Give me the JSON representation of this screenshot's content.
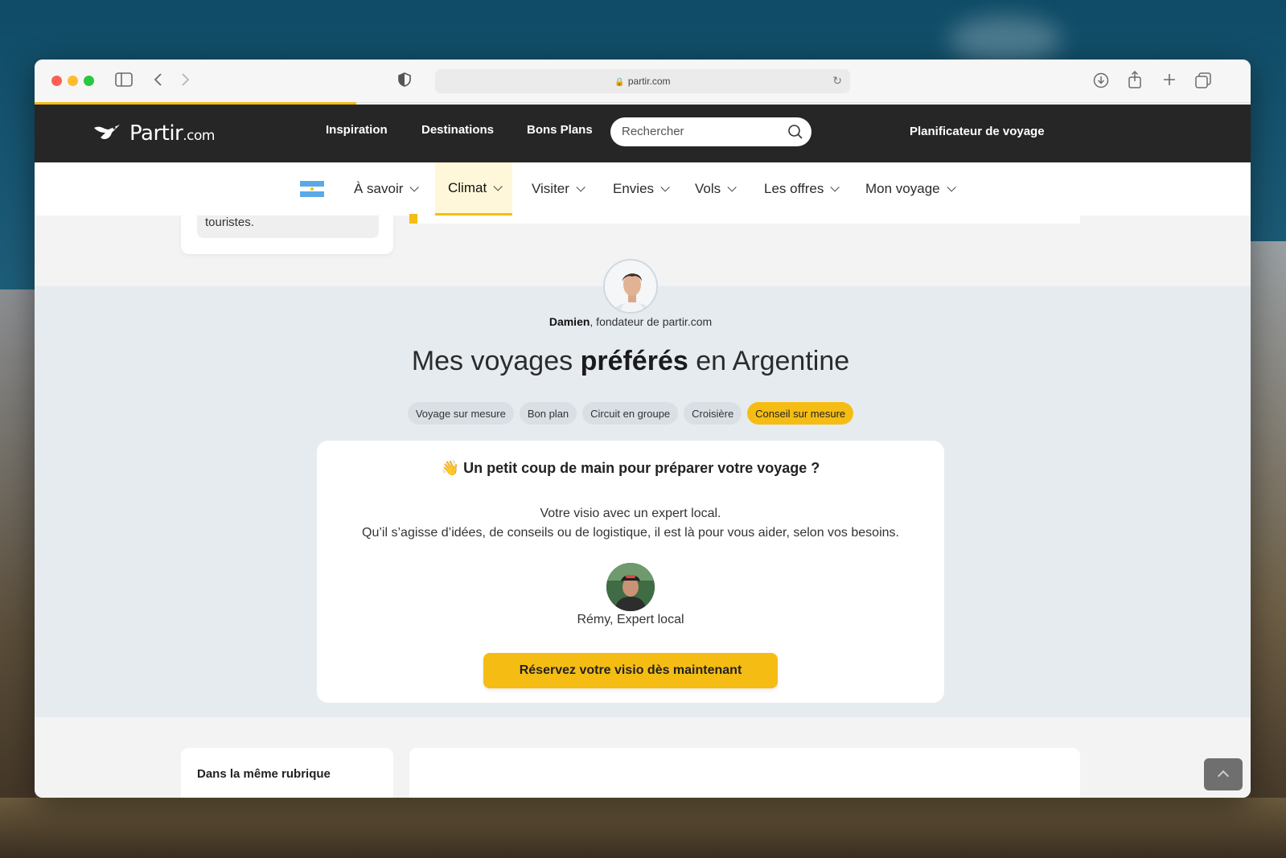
{
  "browser": {
    "url": "partir.com"
  },
  "header": {
    "logo_text": "Partir",
    "logo_suffix": ".com",
    "nav": [
      "Inspiration",
      "Destinations",
      "Bons Plans"
    ],
    "search_placeholder": "Rechercher",
    "planner_label": "Planificateur de voyage"
  },
  "subnav": {
    "items": [
      "À savoir",
      "Climat",
      "Visiter",
      "Envies",
      "Vols",
      "Les offres",
      "Mon voyage"
    ],
    "active": "Climat"
  },
  "sidebar_snippet": "touristes.",
  "founder": {
    "name": "Damien",
    "role": ", fondateur de partir.com"
  },
  "headline": {
    "pre": "Mes voyages ",
    "bold": "préférés",
    "post": " en Argentine"
  },
  "tabs": [
    "Voyage sur mesure",
    "Bon plan",
    "Circuit en groupe",
    "Croisière",
    "Conseil sur mesure"
  ],
  "active_tab": "Conseil sur mesure",
  "expert_card": {
    "title": "👋 Un petit coup de main pour préparer votre voyage ?",
    "line1": "Votre visio avec un expert local.",
    "line2": "Qu’il s’agisse d’idées, de conseils ou de logistique, il est là pour vous aider, selon vos besoins.",
    "expert_name": "Rémy, Expert local",
    "cta": "Réservez votre visio dès maintenant"
  },
  "bottom": {
    "rubrique_title": "Dans la même rubrique"
  },
  "colors": {
    "accent": "#f5bd13",
    "header_bg": "#262626",
    "band_bg": "#e6ebf0"
  }
}
